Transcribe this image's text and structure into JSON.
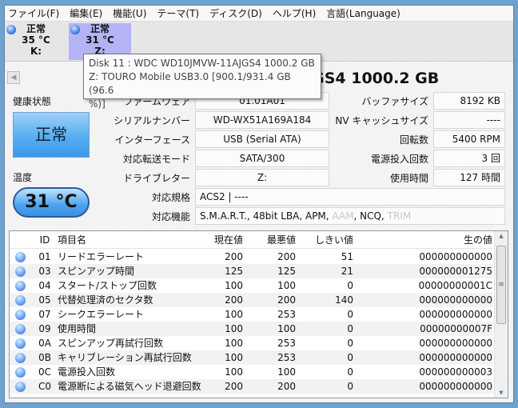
{
  "menu": [
    "ファイル(F)",
    "編集(E)",
    "機能(U)",
    "テーマ(T)",
    "ディスク(D)",
    "ヘルプ(H)",
    "言語(Language)"
  ],
  "disks": [
    {
      "status": "正常",
      "temp": "35 °C",
      "letter": "K:"
    },
    {
      "status": "正常",
      "temp": "31 °C",
      "letter": "Z:"
    }
  ],
  "title": "WDC WD10JMVW-11AJGS4 1000.2 GB",
  "tooltip": {
    "line1": "Disk 11 : WDC WD10JMVW-11AJGS4 1000.2 GB",
    "line2": "Z: TOURO Mobile USB3.0  [900.1/931.4 GB (96.6",
    "line3": "%)]"
  },
  "health": {
    "label": "健康状態",
    "value": "正常",
    "color": "#4aa3ef"
  },
  "temperature": {
    "label": "温度",
    "value": "31 °C"
  },
  "info_left": [
    {
      "label": "ファームウェア",
      "value": "01.01A01"
    },
    {
      "label": "シリアルナンバー",
      "value": "WD-WX51A169A184"
    },
    {
      "label": "インターフェース",
      "value": "USB (Serial ATA)"
    },
    {
      "label": "対応転送モード",
      "value": "SATA/300"
    },
    {
      "label": "ドライブレター",
      "value": "Z:"
    }
  ],
  "info_right": [
    {
      "label": "バッファサイズ",
      "value": "8192 KB"
    },
    {
      "label": "NV キャッシュサイズ",
      "value": "----"
    },
    {
      "label": "回転数",
      "value": "5400 RPM"
    },
    {
      "label": "電源投入回数",
      "value": "3 回"
    },
    {
      "label": "使用時間",
      "value": "127 時間"
    }
  ],
  "standard": {
    "label": "対応規格",
    "value": "ACS2 | ----"
  },
  "features": {
    "label": "対応機能",
    "items": [
      "S.M.A.R.T.",
      ", 48bit LBA",
      ", APM",
      ", ",
      "AAM",
      ", NCQ",
      ", ",
      "TRIM"
    ]
  },
  "smart": {
    "headers": [
      "ID",
      "項目名",
      "現在値",
      "最悪値",
      "しきい値",
      "生の値"
    ],
    "rows": [
      [
        "01",
        "リードエラーレート",
        "200",
        "200",
        "51",
        "000000000000"
      ],
      [
        "03",
        "スピンアップ時間",
        "125",
        "125",
        "21",
        "000000001275"
      ],
      [
        "04",
        "スタート/ストップ回数",
        "100",
        "100",
        "0",
        "00000000001C"
      ],
      [
        "05",
        "代替処理済のセクタ数",
        "200",
        "200",
        "140",
        "000000000000"
      ],
      [
        "07",
        "シークエラーレート",
        "100",
        "253",
        "0",
        "000000000000"
      ],
      [
        "09",
        "使用時間",
        "100",
        "100",
        "0",
        "00000000007F"
      ],
      [
        "0A",
        "スピンアップ再試行回数",
        "100",
        "253",
        "0",
        "000000000000"
      ],
      [
        "0B",
        "キャリブレーション再試行回数",
        "100",
        "253",
        "0",
        "000000000000"
      ],
      [
        "0C",
        "電源投入回数",
        "100",
        "100",
        "0",
        "000000000003"
      ],
      [
        "C0",
        "電源断による磁気ヘッド退避回数",
        "200",
        "200",
        "0",
        "000000000000"
      ]
    ]
  }
}
